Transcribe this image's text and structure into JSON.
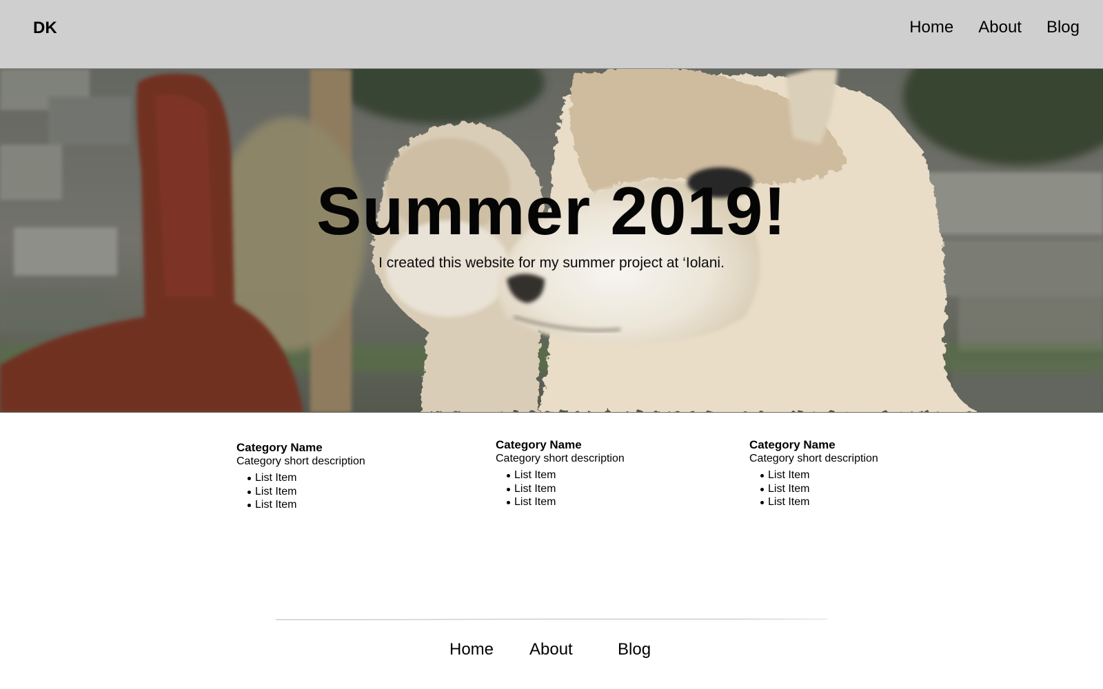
{
  "header": {
    "brand": "DK",
    "nav": [
      "Home",
      "About",
      "Blog"
    ]
  },
  "hero": {
    "title": "Summer 2019!",
    "subtitle": "I created this website for my summer project at ‘Iolani.",
    "image": "alpaca-photo"
  },
  "categories": [
    {
      "name": "Category Name",
      "description": "Category short description",
      "items": [
        "List Item",
        "List Item",
        "List Item"
      ]
    },
    {
      "name": "Category Name",
      "description": "Category short description",
      "items": [
        "List Item",
        "List Item",
        "List Item"
      ]
    },
    {
      "name": "Category Name",
      "description": "Category short description",
      "items": [
        "List Item",
        "List Item",
        "List Item"
      ]
    }
  ],
  "footer": {
    "nav": [
      "Home",
      "About",
      "Blog"
    ]
  },
  "colors": {
    "header_bg": "#cfcfcf",
    "page_bg": "#ffffff",
    "text": "#000000"
  }
}
